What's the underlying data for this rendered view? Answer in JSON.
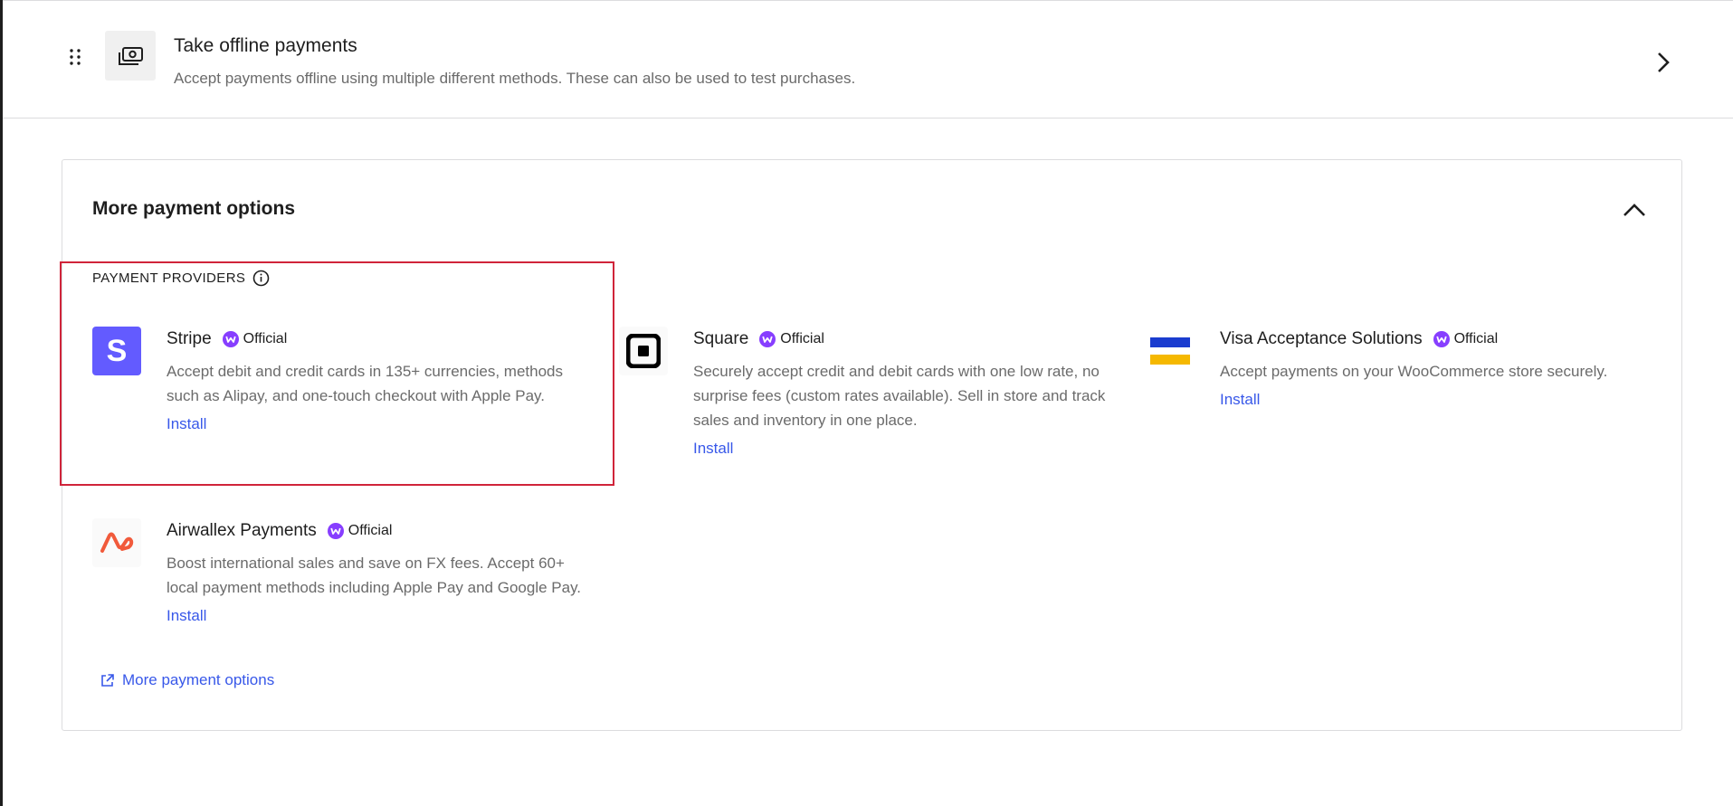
{
  "offline": {
    "title": "Take offline payments",
    "description": "Accept payments offline using multiple different methods. These can also be used to test purchases.",
    "icon": "cash-icon"
  },
  "panel": {
    "title": "More payment options",
    "section_label": "PAYMENT PROVIDERS",
    "providers": [
      {
        "name": "Stripe",
        "badge": "Official",
        "description_lines": [
          "Accept debit and credit cards in 135+ currencies, methods",
          "such as Alipay, and one-touch checkout with Apple Pay."
        ],
        "action": "Install",
        "logo_text": "S",
        "logo_color": "#635bff"
      },
      {
        "name": "Square",
        "badge": "Official",
        "description_lines": [
          "Securely accept credit and debit cards with one low rate, no",
          "surprise fees (custom rates available). Sell in store and track",
          "sales and inventory in one place."
        ],
        "action": "Install"
      },
      {
        "name": "Visa Acceptance Solutions",
        "badge": "Official",
        "description_lines": [
          "Accept payments on your WooCommerce store securely."
        ],
        "action": "Install"
      },
      {
        "name": "Airwallex Payments",
        "badge": "Official",
        "description_lines": [
          "Boost international sales and save on FX fees. Accept 60+",
          "local payment methods including Apple Pay and Google Pay."
        ],
        "action": "Install"
      }
    ],
    "more_link": "More payment options"
  },
  "colors": {
    "link": "#3858e9",
    "badge": "#873eff",
    "highlight": "#d0243a",
    "visa_blue": "#1a3ccf",
    "visa_yellow": "#f5b800"
  }
}
